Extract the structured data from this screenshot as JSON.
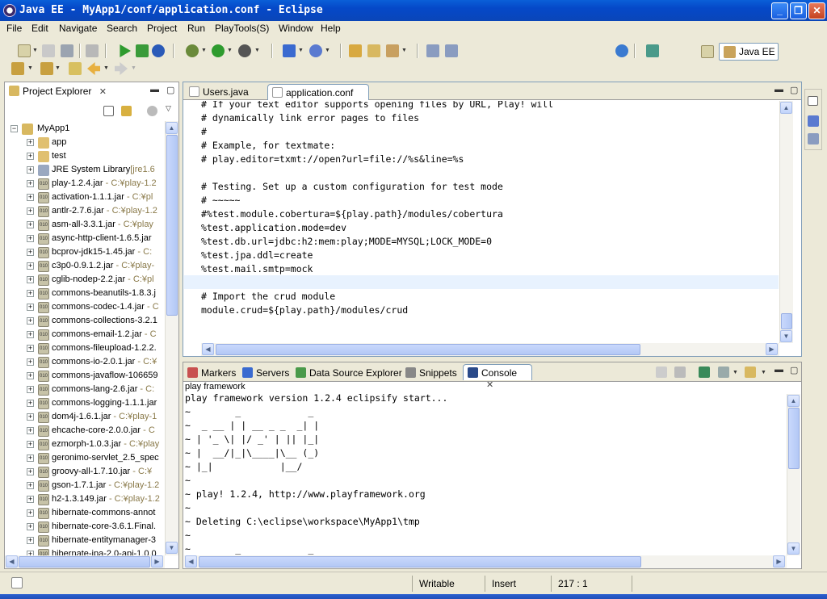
{
  "window": {
    "title": "Java EE - MyApp1/conf/application.conf - Eclipse"
  },
  "menu": [
    "File",
    "Edit",
    "Navigate",
    "Search",
    "Project",
    "Run",
    "PlayTools(S)",
    "Window",
    "Help"
  ],
  "perspective": {
    "label": "Java EE"
  },
  "project_explorer": {
    "tab_label": "Project Explorer",
    "items": [
      {
        "label": "MyApp1",
        "decoration": ""
      },
      {
        "label": "app",
        "decoration": ""
      },
      {
        "label": "test",
        "decoration": ""
      },
      {
        "label": "JRE System Library",
        "decoration": "[jre1.6"
      },
      {
        "label": "play-1.2.4.jar",
        "decoration": " - C:¥play-1.2"
      },
      {
        "label": "activation-1.1.1.jar",
        "decoration": " - C:¥pl"
      },
      {
        "label": "antlr-2.7.6.jar",
        "decoration": " - C:¥play-1.2"
      },
      {
        "label": "asm-all-3.3.1.jar",
        "decoration": " - C:¥play"
      },
      {
        "label": "async-http-client-1.6.5.jar",
        "decoration": ""
      },
      {
        "label": "bcprov-jdk15-1.45.jar",
        "decoration": " - C:"
      },
      {
        "label": "c3p0-0.9.1.2.jar",
        "decoration": " - C:¥play-"
      },
      {
        "label": "cglib-nodep-2.2.jar",
        "decoration": " - C:¥pl"
      },
      {
        "label": "commons-beanutils-1.8.3.j",
        "decoration": ""
      },
      {
        "label": "commons-codec-1.4.jar",
        "decoration": " - C"
      },
      {
        "label": "commons-collections-3.2.1",
        "decoration": ""
      },
      {
        "label": "commons-email-1.2.jar",
        "decoration": " - C"
      },
      {
        "label": "commons-fileupload-1.2.2.",
        "decoration": ""
      },
      {
        "label": "commons-io-2.0.1.jar",
        "decoration": " - C:¥"
      },
      {
        "label": "commons-javaflow-106659",
        "decoration": ""
      },
      {
        "label": "commons-lang-2.6.jar",
        "decoration": " - C:"
      },
      {
        "label": "commons-logging-1.1.1.jar",
        "decoration": ""
      },
      {
        "label": "dom4j-1.6.1.jar",
        "decoration": " - C:¥play-1"
      },
      {
        "label": "ehcache-core-2.0.0.jar",
        "decoration": " - C"
      },
      {
        "label": "ezmorph-1.0.3.jar",
        "decoration": " - C:¥play"
      },
      {
        "label": "geronimo-servlet_2.5_spec",
        "decoration": ""
      },
      {
        "label": "groovy-all-1.7.10.jar",
        "decoration": " - C:¥"
      },
      {
        "label": "gson-1.7.1.jar",
        "decoration": " - C:¥play-1.2"
      },
      {
        "label": "h2-1.3.149.jar",
        "decoration": " - C:¥play-1.2"
      },
      {
        "label": "hibernate-commons-annot",
        "decoration": ""
      },
      {
        "label": "hibernate-core-3.6.1.Final.",
        "decoration": ""
      },
      {
        "label": "hibernate-entitymanager-3",
        "decoration": ""
      },
      {
        "label": "hibernate-jpa-2.0-api-1.0.0",
        "decoration": ""
      }
    ]
  },
  "editor": {
    "tabs": [
      "Users.java",
      "application.conf"
    ],
    "lines": [
      "# If your text editor supports opening files by URL, Play! will",
      "# dynamically link error pages to files",
      "#",
      "# Example, for textmate:",
      "# play.editor=txmt://open?url=file://%s&line=%s",
      "",
      "# Testing. Set up a custom configuration for test mode",
      "# ~~~~~",
      "#%test.module.cobertura=${play.path}/modules/cobertura",
      "%test.application.mode=dev",
      "%test.db.url=jdbc:h2:mem:play;MODE=MYSQL;LOCK_MODE=0",
      "%test.jpa.ddl=create",
      "%test.mail.smtp=mock",
      "",
      "# Import the crud module",
      "module.crud=${play.path}/modules/crud"
    ]
  },
  "bottom_panel": {
    "tabs": [
      "Markers",
      "Servers",
      "Data Source Explorer",
      "Snippets",
      "Console"
    ],
    "console_title": "play framework",
    "lines": [
      "play framework version 1.2.4 eclipsify start...",
      "~        _            _",
      "~  _ __ | | __ _ _  _| |",
      "~ | '_ \\| |/ _' | || |_|",
      "~ |  __/|_|\\____|\\__ (_)",
      "~ |_|            |__/",
      "~",
      "~ play! 1.2.4, http://www.playframework.org",
      "~",
      "~ Deleting C:\\eclipse\\workspace\\MyApp1\\tmp",
      "~",
      "~        _            _"
    ]
  },
  "status": {
    "mode": "Writable",
    "insert": "Insert",
    "position": "217 : 1"
  }
}
